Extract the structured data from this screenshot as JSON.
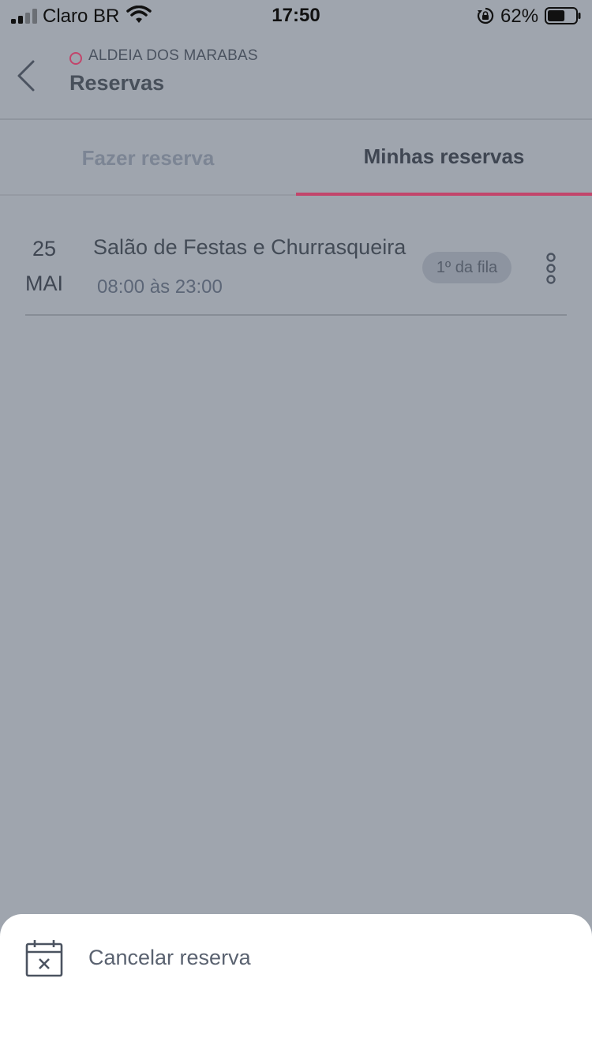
{
  "status_bar": {
    "carrier": "Claro BR",
    "time": "17:50",
    "battery_percent": "62%",
    "battery_level": 0.62
  },
  "header": {
    "org_name": "ALDEIA DOS MARABAS",
    "title": "Reservas",
    "accent_color": "#c2456b"
  },
  "tabs": [
    {
      "label": "Fazer reserva",
      "active": false
    },
    {
      "label": "Minhas reservas",
      "active": true
    }
  ],
  "reservations": [
    {
      "day": "25",
      "month": "MAI",
      "title": "Salão de Festas e Churrasqueira",
      "time": "08:00 às 23:00",
      "badge": "1º da fila"
    }
  ],
  "sheet": {
    "items": [
      {
        "label": "Cancelar reserva",
        "icon": "calendar-cancel-icon"
      }
    ]
  }
}
